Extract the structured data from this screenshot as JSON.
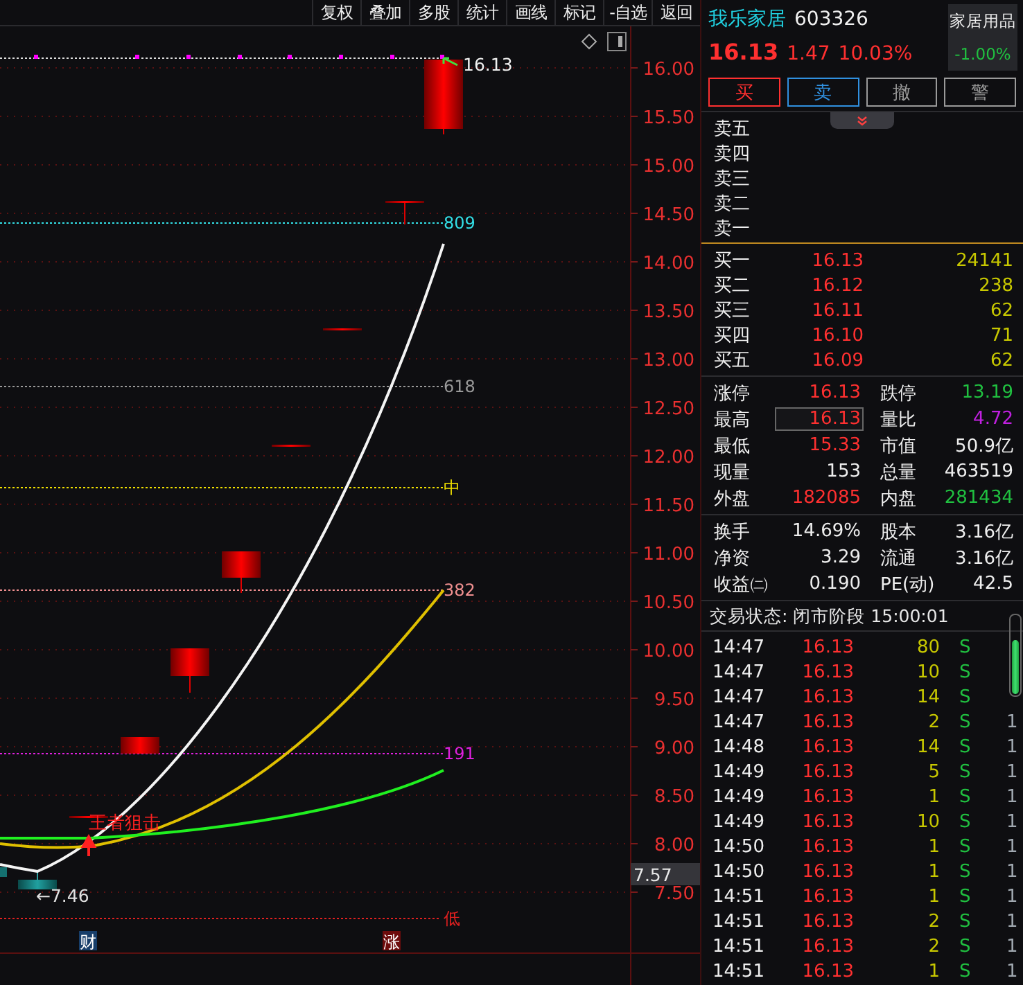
{
  "toolbar": [
    {
      "label": "复权"
    },
    {
      "label": "叠加"
    },
    {
      "label": "多股"
    },
    {
      "label": "统计"
    },
    {
      "label": "画线"
    },
    {
      "label": "标记"
    },
    {
      "label": "-自选"
    },
    {
      "label": "返回"
    }
  ],
  "chart": {
    "price_axis": [
      "16.00",
      "15.50",
      "15.00",
      "14.50",
      "14.00",
      "13.50",
      "13.00",
      "12.50",
      "12.00",
      "11.50",
      "11.00",
      "10.50",
      "10.00",
      "9.50",
      "9.00",
      "8.50",
      "8.00",
      "7.50"
    ],
    "high_tag": "16.13",
    "low_tag": "←7.46",
    "current_tag": "7.57",
    "signal": "王者狙击",
    "fib_levels": [
      {
        "label": "809",
        "color": "#33e0e8"
      },
      {
        "label": "618",
        "color": "#9a9a9a"
      },
      {
        "label": "中",
        "color": "#f0e000"
      },
      {
        "label": "382",
        "color": "#f09090"
      },
      {
        "label": "191",
        "color": "#e020e0"
      },
      {
        "label": "低",
        "color": "#e02020"
      }
    ],
    "markers": [
      {
        "label": "财",
        "color": "#173e6a"
      },
      {
        "label": "涨",
        "color": "#6e0c0c"
      }
    ]
  },
  "quote": {
    "name": "我乐家居",
    "code": "603326",
    "price": "16.13",
    "change": "1.47",
    "change_pct": "10.03%",
    "sector": "家居用品",
    "sector_change": "-1.00%"
  },
  "actions": [
    {
      "label": "买",
      "kind": "buy"
    },
    {
      "label": "卖",
      "kind": "sell"
    },
    {
      "label": "撤",
      "kind": "plain"
    },
    {
      "label": "警",
      "kind": "plain"
    }
  ],
  "asks": [
    {
      "label": "卖五"
    },
    {
      "label": "卖四"
    },
    {
      "label": "卖三"
    },
    {
      "label": "卖二"
    },
    {
      "label": "卖一"
    }
  ],
  "bids": [
    {
      "label": "买一",
      "price": "16.13",
      "volume": "24141"
    },
    {
      "label": "买二",
      "price": "16.12",
      "volume": "238"
    },
    {
      "label": "买三",
      "price": "16.11",
      "volume": "62"
    },
    {
      "label": "买四",
      "price": "16.10",
      "volume": "71"
    },
    {
      "label": "买五",
      "price": "16.09",
      "volume": "62"
    }
  ],
  "stats": [
    {
      "label": "涨停",
      "value": "16.13",
      "color": "#ff3030",
      "highlighted": false
    },
    {
      "label": "跌停",
      "value": "13.19",
      "color": "#20c040",
      "highlighted": false
    },
    {
      "label": "最高",
      "value": "16.13",
      "color": "#ff3030",
      "highlighted": true
    },
    {
      "label": "量比",
      "value": "4.72",
      "color": "#c020e0",
      "highlighted": false
    },
    {
      "label": "最低",
      "value": "15.33",
      "color": "#ff3030",
      "highlighted": false
    },
    {
      "label": "市值",
      "value": "50.9亿",
      "color": "#eeeeee",
      "highlighted": false
    },
    {
      "label": "现量",
      "value": "153",
      "color": "#eeeeee",
      "highlighted": false
    },
    {
      "label": "总量",
      "value": "463519",
      "color": "#eeeeee",
      "highlighted": false
    },
    {
      "label": "外盘",
      "value": "182085",
      "color": "#ff3030",
      "highlighted": false
    },
    {
      "label": "内盘",
      "value": "281434",
      "color": "#20c040",
      "highlighted": false
    }
  ],
  "fundamentals": [
    {
      "label": "换手",
      "value": "14.69%"
    },
    {
      "label": "股本",
      "value": "3.16亿"
    },
    {
      "label": "净资",
      "value": "3.29"
    },
    {
      "label": "流通",
      "value": "3.16亿"
    },
    {
      "label": "收益㈡",
      "value": "0.190"
    },
    {
      "label": "PE(动)",
      "value": "42.5"
    }
  ],
  "status": "交易状态: 闭市阶段 15:00:01",
  "trades": [
    {
      "time": "14:47",
      "price": "16.13",
      "volume": "80",
      "side": "S"
    },
    {
      "time": "14:47",
      "price": "16.13",
      "volume": "10",
      "side": "S"
    },
    {
      "time": "14:47",
      "price": "16.13",
      "volume": "14",
      "side": "S"
    },
    {
      "time": "14:47",
      "price": "16.13",
      "volume": "2",
      "side": "S",
      "count": "1"
    },
    {
      "time": "14:48",
      "price": "16.13",
      "volume": "14",
      "side": "S",
      "count": "1"
    },
    {
      "time": "14:49",
      "price": "16.13",
      "volume": "5",
      "side": "S",
      "count": "1"
    },
    {
      "time": "14:49",
      "price": "16.13",
      "volume": "1",
      "side": "S",
      "count": "1"
    },
    {
      "time": "14:49",
      "price": "16.13",
      "volume": "10",
      "side": "S",
      "count": "1"
    },
    {
      "time": "14:50",
      "price": "16.13",
      "volume": "1",
      "side": "S",
      "count": "1"
    },
    {
      "time": "14:50",
      "price": "16.13",
      "volume": "1",
      "side": "S",
      "count": "1"
    },
    {
      "time": "14:51",
      "price": "16.13",
      "volume": "1",
      "side": "S",
      "count": "1"
    },
    {
      "time": "14:51",
      "price": "16.13",
      "volume": "2",
      "side": "S",
      "count": "1"
    },
    {
      "time": "14:51",
      "price": "16.13",
      "volume": "2",
      "side": "S",
      "count": "1"
    },
    {
      "time": "14:51",
      "price": "16.13",
      "volume": "1",
      "side": "S",
      "count": "1"
    }
  ]
}
